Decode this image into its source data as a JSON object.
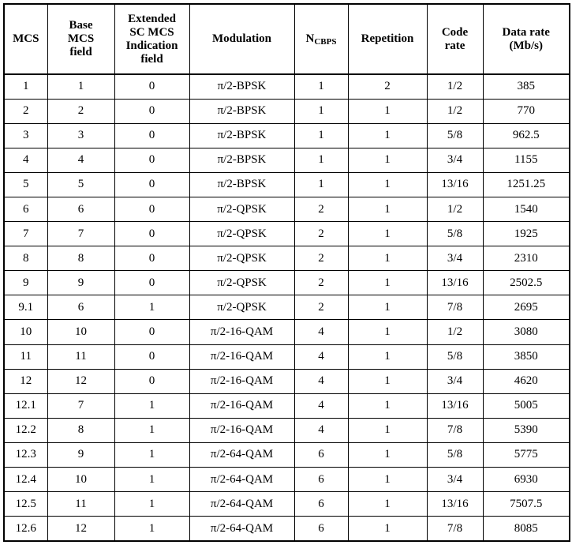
{
  "headers": {
    "mcs": "MCS",
    "base_l1": "Base",
    "base_l2": "MCS",
    "base_l3": "field",
    "ext_l1": "Extended",
    "ext_l2": "SC MCS",
    "ext_l3": "Indication",
    "ext_l4": "field",
    "modulation": "Modulation",
    "ncbps_main": "N",
    "ncbps_sub": "CBPS",
    "repetition": "Repetition",
    "code_l1": "Code",
    "code_l2": "rate",
    "rate_l1": "Data rate",
    "rate_l2": "(Mb/s)"
  },
  "rows": [
    [
      "1",
      "1",
      "0",
      "π/2-BPSK",
      "1",
      "2",
      "1/2",
      "385"
    ],
    [
      "2",
      "2",
      "0",
      "π/2-BPSK",
      "1",
      "1",
      "1/2",
      "770"
    ],
    [
      "3",
      "3",
      "0",
      "π/2-BPSK",
      "1",
      "1",
      "5/8",
      "962.5"
    ],
    [
      "4",
      "4",
      "0",
      "π/2-BPSK",
      "1",
      "1",
      "3/4",
      "1155"
    ],
    [
      "5",
      "5",
      "0",
      "π/2-BPSK",
      "1",
      "1",
      "13/16",
      "1251.25"
    ],
    [
      "6",
      "6",
      "0",
      "π/2-QPSK",
      "2",
      "1",
      "1/2",
      "1540"
    ],
    [
      "7",
      "7",
      "0",
      "π/2-QPSK",
      "2",
      "1",
      "5/8",
      "1925"
    ],
    [
      "8",
      "8",
      "0",
      "π/2-QPSK",
      "2",
      "1",
      "3/4",
      "2310"
    ],
    [
      "9",
      "9",
      "0",
      "π/2-QPSK",
      "2",
      "1",
      "13/16",
      "2502.5"
    ],
    [
      "9.1",
      "6",
      "1",
      "π/2-QPSK",
      "2",
      "1",
      "7/8",
      "2695"
    ],
    [
      "10",
      "10",
      "0",
      "π/2-16-QAM",
      "4",
      "1",
      "1/2",
      "3080"
    ],
    [
      "11",
      "11",
      "0",
      "π/2-16-QAM",
      "4",
      "1",
      "5/8",
      "3850"
    ],
    [
      "12",
      "12",
      "0",
      "π/2-16-QAM",
      "4",
      "1",
      "3/4",
      "4620"
    ],
    [
      "12.1",
      "7",
      "1",
      "π/2-16-QAM",
      "4",
      "1",
      "13/16",
      "5005"
    ],
    [
      "12.2",
      "8",
      "1",
      "π/2-16-QAM",
      "4",
      "1",
      "7/8",
      "5390"
    ],
    [
      "12.3",
      "9",
      "1",
      "π/2-64-QAM",
      "6",
      "1",
      "5/8",
      "5775"
    ],
    [
      "12.4",
      "10",
      "1",
      "π/2-64-QAM",
      "6",
      "1",
      "3/4",
      "6930"
    ],
    [
      "12.5",
      "11",
      "1",
      "π/2-64-QAM",
      "6",
      "1",
      "13/16",
      "7507.5"
    ],
    [
      "12.6",
      "12",
      "1",
      "π/2-64-QAM",
      "6",
      "1",
      "7/8",
      "8085"
    ]
  ]
}
